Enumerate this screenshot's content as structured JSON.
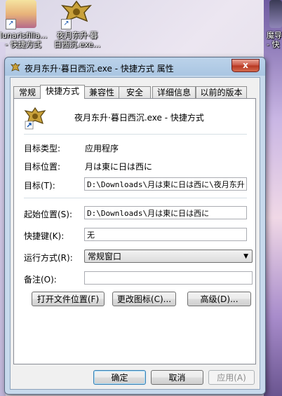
{
  "desktop": {
    "icons": [
      {
        "label_line1": "lunarisfilia...",
        "label_line2": "- 快捷方式"
      },
      {
        "label_line1": "夜月东升·暮",
        "label_line2": "日西沉.exe..."
      },
      {
        "label_line1": "魔导",
        "label_line2": "- 快"
      }
    ]
  },
  "dialog": {
    "title": "夜月东升·暮日西沉.exe - 快捷方式 属性",
    "close_label": "x",
    "tabs": [
      "常规",
      "快捷方式",
      "兼容性",
      "安全",
      "详细信息",
      "以前的版本"
    ],
    "active_tab": "快捷方式",
    "shortcut_name": "夜月东升·暮日西沉.exe - 快捷方式",
    "target_type_label": "目标类型:",
    "target_type_value": "应用程序",
    "target_location_label": "目标位置:",
    "target_location_value": "月は東に日は西に",
    "target_label": "目标(T):",
    "target_value": "D:\\Downloads\\月は東に日は西に\\夜月东升·",
    "start_in_label": "起始位置(S):",
    "start_in_value": "D:\\Downloads\\月は東に日は西に",
    "hotkey_label": "快捷键(K):",
    "hotkey_value": "无",
    "run_label": "运行方式(R):",
    "run_value": "常规窗口",
    "comment_label": "备注(O):",
    "comment_value": "",
    "open_location_button": "打开文件位置(F)",
    "change_icon_button": "更改图标(C)...",
    "advanced_button": "高级(D)...",
    "ok_button": "确定",
    "cancel_button": "取消",
    "apply_button": "应用(A)"
  }
}
